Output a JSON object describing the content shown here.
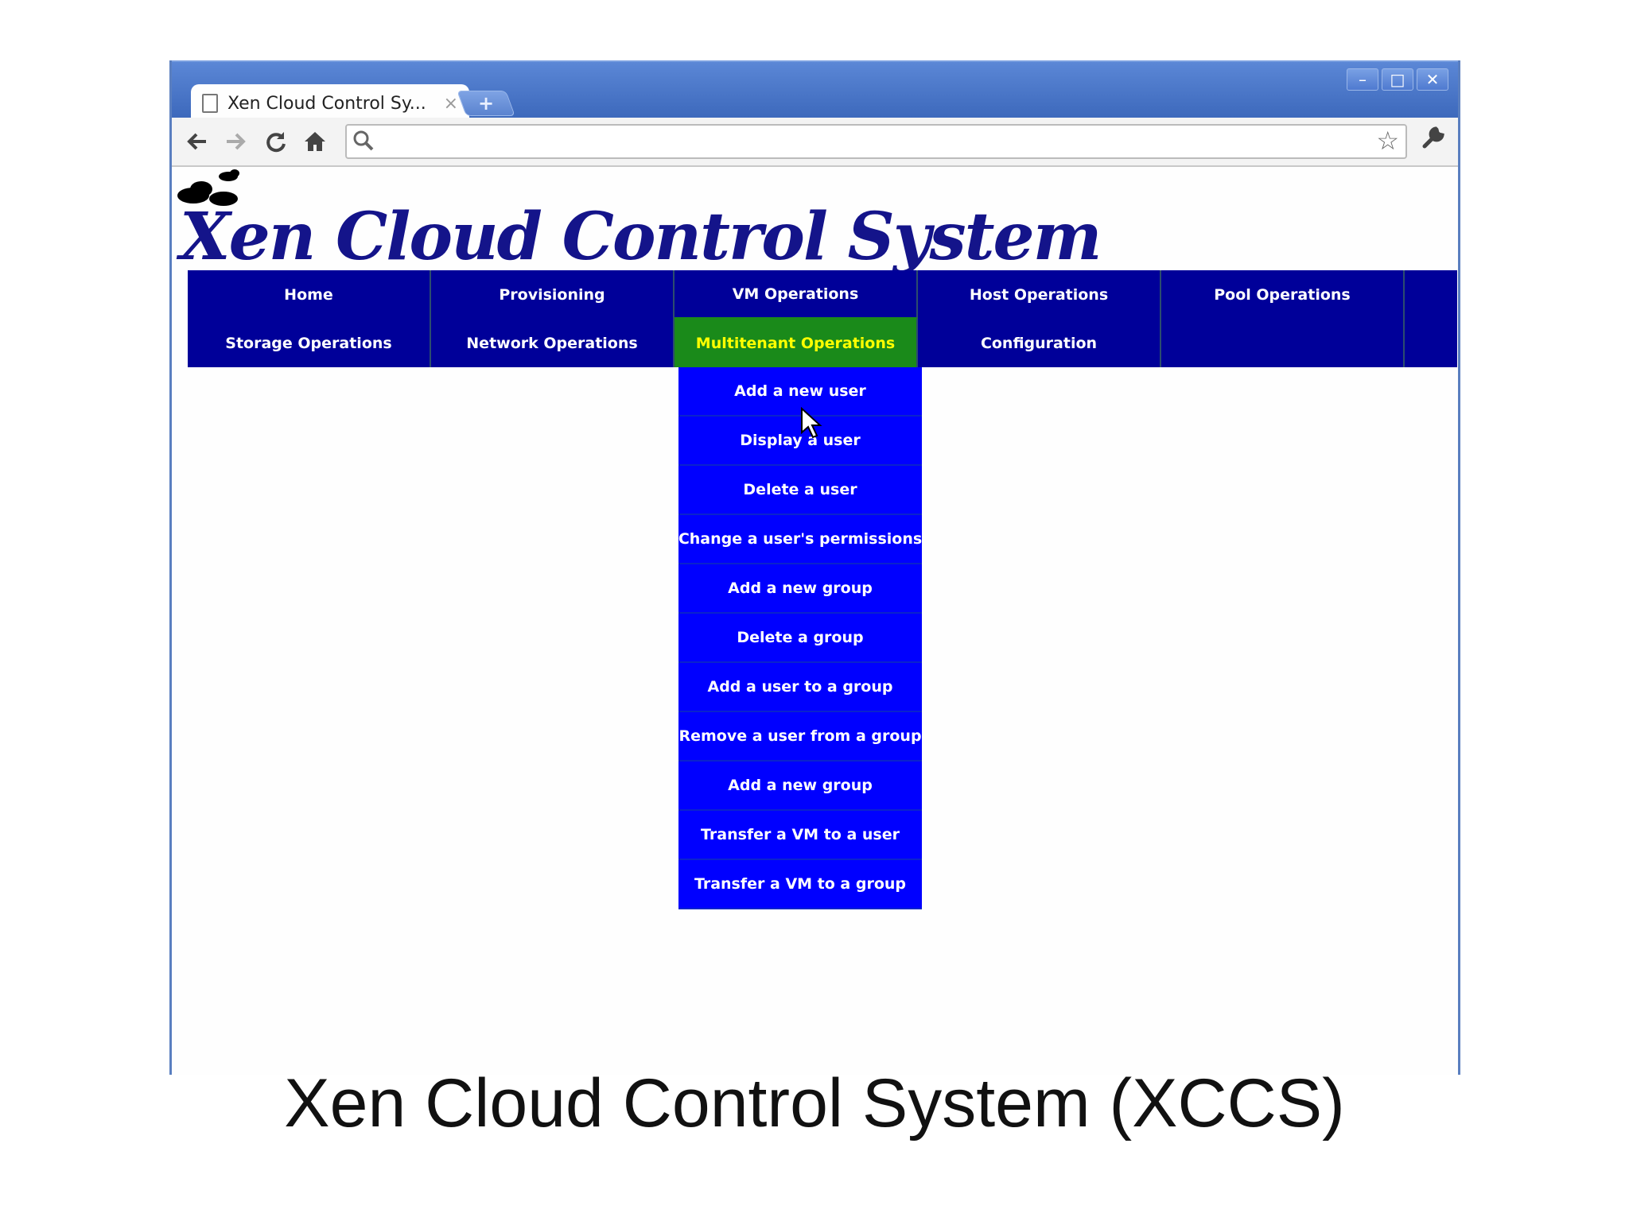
{
  "browser": {
    "tab_title": "Xen Cloud Control Sy...",
    "tab_close": "×",
    "new_tab": "+",
    "win_minimize": "–",
    "win_maximize": "□",
    "win_close": "✕",
    "back": "🡐",
    "forward": "🡒",
    "reload": "↻",
    "home": "⌂",
    "search_glyph": "⚲",
    "star": "☆",
    "wrench": "🔧"
  },
  "site": {
    "title": "Xen Cloud Control System"
  },
  "menu": {
    "row1": [
      "Home",
      "Provisioning",
      "VM Operations",
      "Host Operations",
      "Pool Operations"
    ],
    "row2": [
      "Storage Operations",
      "Network Operations",
      "Multitenant Operations",
      "Configuration"
    ]
  },
  "dropdown": {
    "items": [
      "Add a new user",
      "Display a user",
      "Delete a user",
      "Change a user's permissions",
      "Add a new group",
      "Delete a group",
      "Add a user to a group",
      "Remove a user from a group",
      "Add a new group",
      "Transfer a VM to a user",
      "Transfer a VM to a group"
    ]
  },
  "caption": "Xen Cloud Control System (XCCS)",
  "colors": {
    "menubar": "#000099",
    "active_menu": "#1a8a1a",
    "active_text": "#ffff00",
    "dropdown": "#0000ff",
    "title": "#14148a"
  }
}
